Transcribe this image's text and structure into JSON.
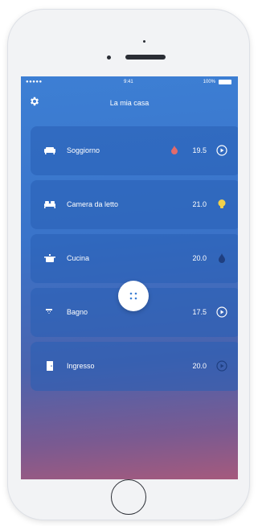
{
  "status_bar": {
    "signal": "●●●●● ",
    "time": "9:41",
    "battery": "100%"
  },
  "header": {
    "title": "La mia casa",
    "settings_icon": "gear-icon"
  },
  "rooms": [
    {
      "name": "Soggiorno",
      "icon": "sofa-icon",
      "temperature": "19.5",
      "status_icon": "play-circle-icon",
      "extra_icon": "flame-icon",
      "extra_color": "#e26b6b"
    },
    {
      "name": "Camera da letto",
      "icon": "bed-icon",
      "temperature": "21.0",
      "status_icon": "lightbulb-icon",
      "status_color": "#f2d14a"
    },
    {
      "name": "Cucina",
      "icon": "pot-icon",
      "temperature": "20.0",
      "status_icon": "drop-icon",
      "status_color": "#1f3f80"
    },
    {
      "name": "Bagno",
      "icon": "shower-icon",
      "temperature": "17.5",
      "status_icon": "play-circle-icon"
    },
    {
      "name": "Ingresso",
      "icon": "door-icon",
      "temperature": "20.0",
      "status_icon": "play-circle-icon"
    }
  ],
  "fab": {
    "icon": "grid-icon"
  },
  "colors": {
    "accent": "#3d7fd4",
    "card": "#2f64b8",
    "bulb": "#f2d14a",
    "flame": "#e26b6b"
  }
}
